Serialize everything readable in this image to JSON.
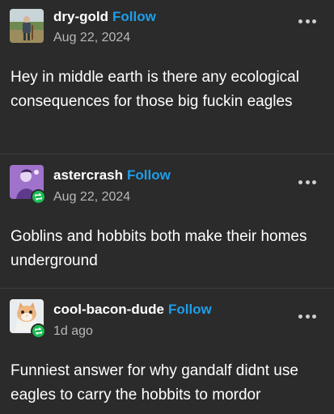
{
  "posts": [
    {
      "username": "dry-gold",
      "follow_label": "Follow",
      "date": "Aug 22, 2024",
      "avatar": "person-in-field-avatar",
      "reblogged": false,
      "text": "Hey in middle earth is there any ecological consequences for those big fuckin eagles"
    },
    {
      "username": "astercrash",
      "follow_label": "Follow",
      "date": "Aug 22, 2024",
      "avatar": "purple-portrait-avatar",
      "reblogged": true,
      "text": "Goblins and hobbits both make their homes underground"
    },
    {
      "username": "cool-bacon-dude",
      "follow_label": "Follow",
      "date": "1d ago",
      "avatar": "cat-avatar",
      "reblogged": true,
      "text": "Funniest answer for why gandalf didnt use eagles to carry the hobbits to mordor"
    }
  ],
  "colors": {
    "background": "#2b2b2b",
    "follow_link": "#1e9ee9",
    "reblog_badge": "#1dbd55",
    "secondary_text": "#b8b8b8"
  }
}
